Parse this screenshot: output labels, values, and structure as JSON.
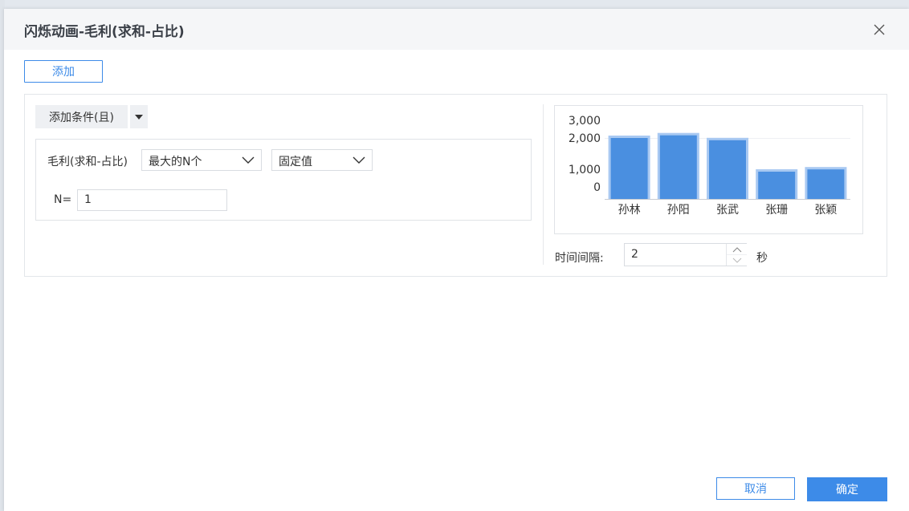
{
  "dialog": {
    "title": "闪烁动画-毛利(求和-占比)",
    "close_icon": "close-icon"
  },
  "toolbar": {
    "add_label": "添加"
  },
  "condition": {
    "add_condition_label": "添加条件(且)",
    "dropdown_icon": "caret-down-icon",
    "field_label": "毛利(求和-占比)",
    "rank_select": "最大的N个",
    "value_type_select": "固定值",
    "n_label": "N=",
    "n_value": "1"
  },
  "preview": {
    "interval_label": "时间间隔:",
    "interval_value": "2",
    "interval_unit": "秒"
  },
  "chart_data": {
    "type": "bar",
    "categories": [
      "孙林",
      "孙阳",
      "张武",
      "张珊",
      "张颖"
    ],
    "values": [
      2000,
      2150,
      1950,
      1250,
      1300
    ],
    "ytick_labels": [
      "3,000",
      "2,000",
      "1,000",
      "0"
    ],
    "ytick_values": [
      3000,
      2000,
      1000,
      0
    ],
    "bar_color": "#4a8fe0",
    "bar_border_color": "#a9c9f2",
    "grid": false
  },
  "footer": {
    "cancel_label": "取消",
    "ok_label": "确定"
  },
  "colors": {
    "accent": "#3d8be8"
  }
}
